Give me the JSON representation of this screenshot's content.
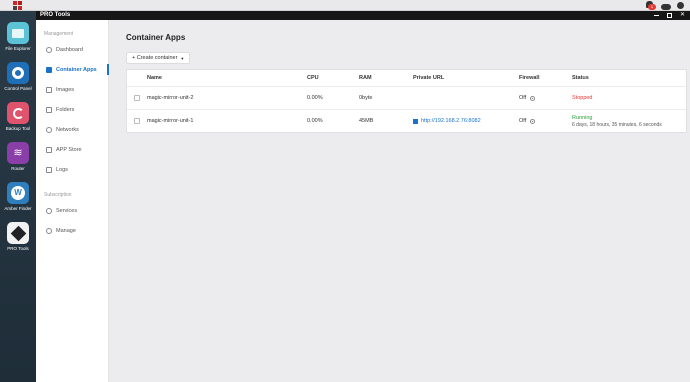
{
  "window": {
    "title": "PRO Tools"
  },
  "system": {
    "notification_count": "1"
  },
  "dock": [
    {
      "label": "File Explorer",
      "icon": "folder-icon"
    },
    {
      "label": "Control Panel",
      "icon": "gear-icon"
    },
    {
      "label": "Backup Tool",
      "icon": "backup-icon"
    },
    {
      "label": "Router",
      "icon": "wifi-icon"
    },
    {
      "label": "Amber Finder",
      "icon": "amber-icon"
    },
    {
      "label": "PRO Tools",
      "icon": "cube-icon"
    }
  ],
  "sidebar": {
    "management_label": "Management",
    "subscription_label": "Subscription",
    "items": [
      {
        "label": "Dashboard",
        "icon": "dashboard-icon"
      },
      {
        "label": "Container Apps",
        "icon": "container-icon"
      },
      {
        "label": "Images",
        "icon": "image-icon"
      },
      {
        "label": "Folders",
        "icon": "folder-icon"
      },
      {
        "label": "Networks",
        "icon": "network-icon"
      },
      {
        "label": "APP Store",
        "icon": "store-icon"
      },
      {
        "label": "Logs",
        "icon": "logs-icon"
      },
      {
        "label": "Services",
        "icon": "services-icon"
      },
      {
        "label": "Manage",
        "icon": "manage-icon"
      }
    ]
  },
  "main": {
    "title": "Container Apps",
    "create_button": "+ Create container",
    "columns": {
      "name": "Name",
      "cpu": "CPU",
      "ram": "RAM",
      "private_url": "Private URL",
      "firewall": "Firewall",
      "status": "Status"
    },
    "rows": [
      {
        "name": "magic-mirror-unit-2",
        "cpu": "0.00%",
        "ram": "0byte",
        "url": "",
        "firewall": "Off",
        "status": "Stopped",
        "uptime": ""
      },
      {
        "name": "magic-mirror-unit-1",
        "cpu": "0.00%",
        "ram": "45MB",
        "url": "http://192.168.2.76:8082",
        "firewall": "Off",
        "status": "Running",
        "uptime": "6 days, 18 hours, 35 minutes, 6 seconds"
      }
    ]
  },
  "colors": {
    "accent": "#1a73c8",
    "running": "#2e9e3e",
    "stopped": "#e53935"
  }
}
